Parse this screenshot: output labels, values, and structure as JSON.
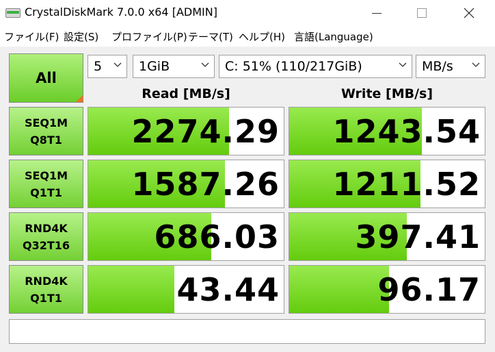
{
  "window": {
    "title": "CrystalDiskMark 7.0.0 x64 [ADMIN]"
  },
  "menu": {
    "items": [
      "ファイル(F)",
      "設定(S)",
      "プロファイル(P)",
      "テーマ(T)",
      "ヘルプ(H)",
      "言語(Language)"
    ]
  },
  "controls": {
    "all_label": "All",
    "count": "5",
    "size": "1GiB",
    "drive": "C: 51% (110/217GiB)",
    "unit": "MB/s"
  },
  "headers": {
    "read": "Read [MB/s]",
    "write": "Write [MB/s]"
  },
  "tests": [
    {
      "line1": "SEQ1M",
      "line2": "Q8T1",
      "read": "2274.29",
      "write": "1243.54",
      "read_fill": 0.72,
      "write_fill": 0.68
    },
    {
      "line1": "SEQ1M",
      "line2": "Q1T1",
      "read": "1587.26",
      "write": "1211.52",
      "read_fill": 0.7,
      "write_fill": 0.67
    },
    {
      "line1": "RND4K",
      "line2": "Q32T16",
      "read": "686.03",
      "write": "397.41",
      "read_fill": 0.63,
      "write_fill": 0.6
    },
    {
      "line1": "RND4K",
      "line2": "Q1T1",
      "read": "43.44",
      "write": "96.17",
      "read_fill": 0.44,
      "write_fill": 0.51
    }
  ],
  "comment": "",
  "colors": {
    "bar": "#7ad81e",
    "button": "#8fdc4c",
    "corner": "#e87722"
  }
}
